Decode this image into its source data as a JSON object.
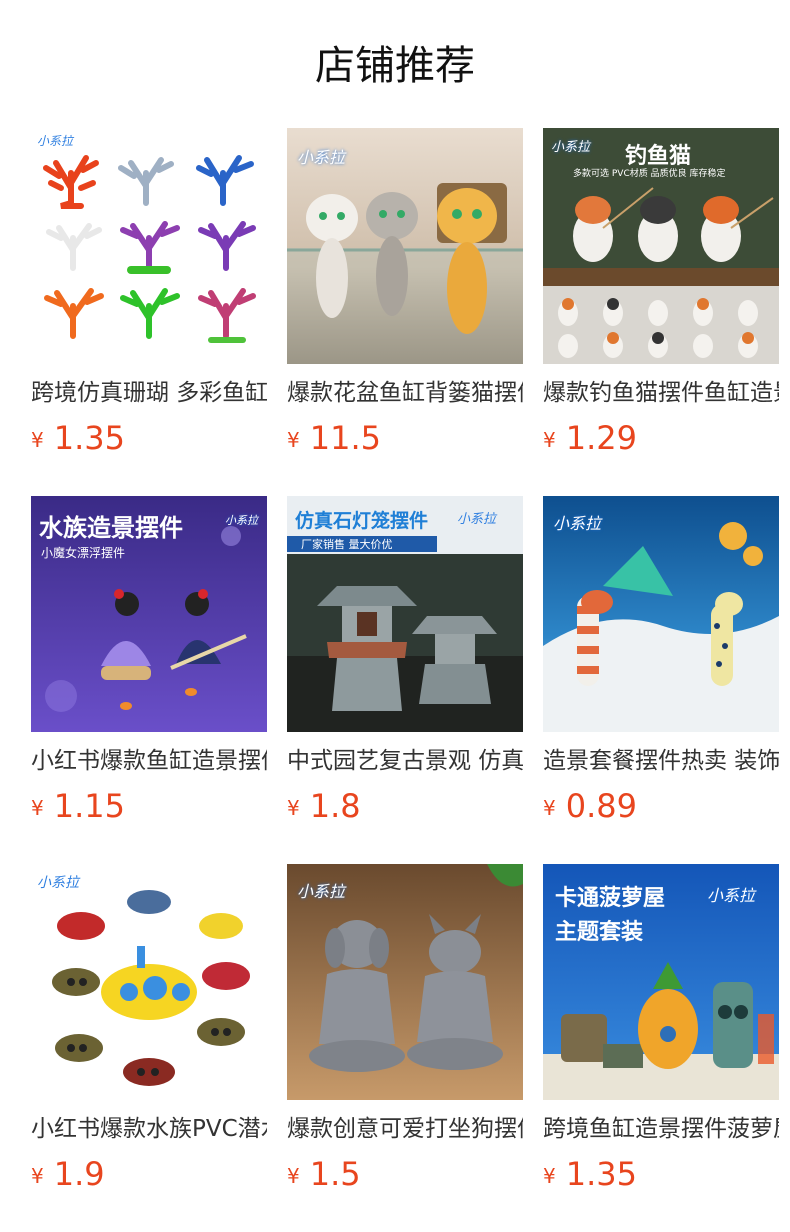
{
  "page": {
    "title": "店铺推荐"
  },
  "currency_symbol": "¥",
  "products": [
    {
      "name": "跨境仿真珊瑚 多彩鱼缸造景装饰",
      "price": "1.35",
      "image_icon": "coral-decoration-image",
      "logo": "小系拉"
    },
    {
      "name": "爆款花盆鱼缸背篓猫摆件",
      "price": "11.5",
      "image_icon": "basket-cats-image",
      "logo": "小系拉"
    },
    {
      "name": "爆款钓鱼猫摆件鱼缸造景",
      "price": "1.29",
      "image_icon": "fishing-cats-image",
      "logo": "小系拉",
      "overlay_title": "钓鱼猫",
      "overlay_sub": "多款可选 PVC材质 品质优良 库存稳定"
    },
    {
      "name": "小红书爆款鱼缸造景摆件",
      "price": "1.15",
      "image_icon": "witch-figurine-image",
      "logo": "小系拉",
      "overlay_title": "水族造景摆件",
      "overlay_sub": "小魔女漂浮摆件"
    },
    {
      "name": "中式园艺复古景观 仿真石灯笼",
      "price": "1.8",
      "image_icon": "stone-lantern-image",
      "logo": "小系拉",
      "overlay_title": "仿真石灯笼摆件",
      "overlay_sub": "厂家销售  量大价优"
    },
    {
      "name": "造景套餐摆件热卖 装饰",
      "price": "0.89",
      "image_icon": "garden-eel-image",
      "logo": "小系拉"
    },
    {
      "name": "小红书爆款水族PVC潜水艇",
      "price": "1.9",
      "image_icon": "submarine-image",
      "logo": "小系拉"
    },
    {
      "name": "爆款创意可爱打坐狗摆件",
      "price": "1.5",
      "image_icon": "meditating-dog-image",
      "logo": "小系拉"
    },
    {
      "name": "跨境鱼缸造景摆件菠萝屋",
      "price": "1.35",
      "image_icon": "pineapple-house-image",
      "logo": "小系拉",
      "overlay_title": "卡通菠萝屋",
      "overlay_sub": "主题套装"
    }
  ],
  "colors": {
    "price": "#e8451e",
    "title": "#111111",
    "product_name": "#333333"
  }
}
